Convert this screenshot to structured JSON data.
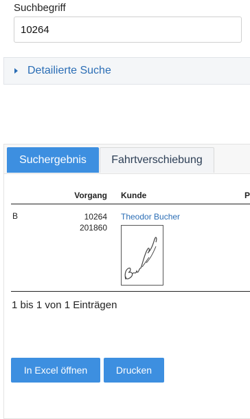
{
  "search": {
    "label": "Suchbegriff",
    "value": "10264"
  },
  "detail_search": {
    "label": "Detailierte Suche"
  },
  "tabs": [
    {
      "label": "Suchergebnis",
      "active": true
    },
    {
      "label": "Fahrtverschiebung",
      "active": false
    }
  ],
  "table": {
    "columns": [
      "",
      "Vorgang",
      "Kunde",
      "P"
    ],
    "rows": [
      {
        "status": "B",
        "vorgang": [
          "10264",
          "201860"
        ],
        "kunde": "Theodor Bucher",
        "signature": "Bucher"
      }
    ]
  },
  "entries_info": "1 bis 1 von 1 Einträgen",
  "buttons": {
    "excel": "In Excel öffnen",
    "print": "Drucken"
  },
  "colors": {
    "accent": "#3d8fe0",
    "link": "#2a6db5"
  }
}
